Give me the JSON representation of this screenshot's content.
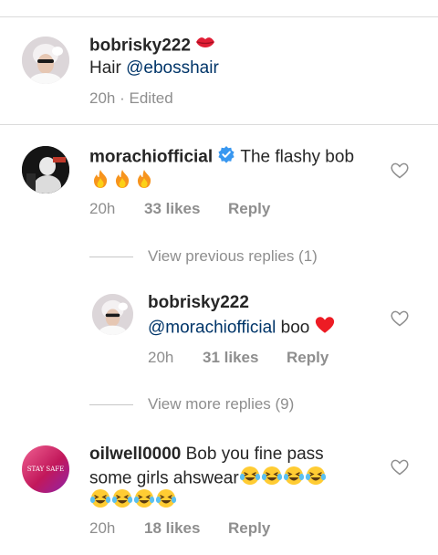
{
  "caption": {
    "username": "bobrisky222",
    "lips_emoji": "💋",
    "text_prefix": "Hair ",
    "mention": "@ebosshair",
    "time": "20h",
    "separator": "·",
    "edited": "Edited"
  },
  "comments": [
    {
      "username": "morachiofficial",
      "verified": true,
      "text": "The flashy bob",
      "emojis": "🔥🔥🔥",
      "time": "20h",
      "likes": "33 likes",
      "reply": "Reply"
    },
    {
      "view_previous": "View previous replies (1)"
    },
    {
      "username": "bobrisky222",
      "mention": "@morachiofficial",
      "text": " boo ",
      "heart_emoji": "❤",
      "time": "20h",
      "likes": "31 likes",
      "reply": "Reply"
    },
    {
      "view_more": "View more replies (9)"
    },
    {
      "username": "oilwell0000",
      "text_line1": " Bob you fine pass",
      "text_line2": "some girls ahswear",
      "avatar_text": "STAY SAFE",
      "time": "20h",
      "likes": "18 likes",
      "reply": "Reply"
    }
  ],
  "colors": {
    "text": "#262626",
    "meta": "#8e8e8e",
    "mention": "#003569",
    "verified": "#3897f0",
    "divider": "#dbdbdb",
    "heart_red": "#ed1c24"
  },
  "icons": [
    "heart-outline-icon",
    "verified-badge-icon",
    "fire-emoji",
    "laughing-tears-emoji",
    "lips-emoji",
    "red-heart-emoji"
  ]
}
